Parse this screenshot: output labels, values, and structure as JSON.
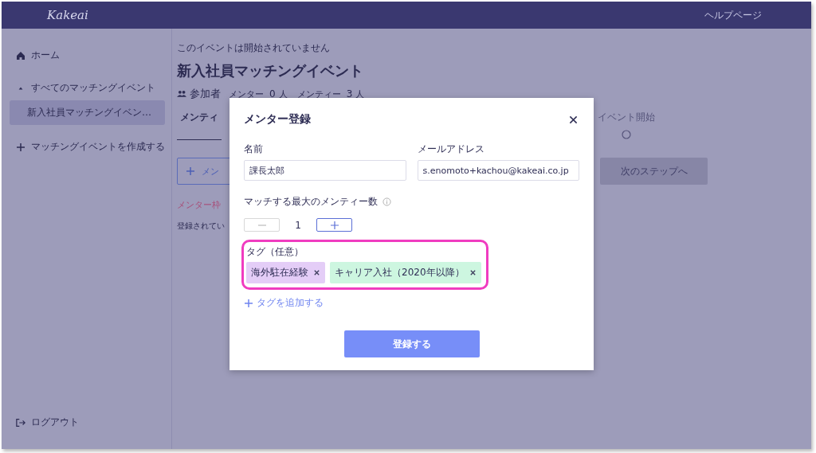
{
  "header": {
    "logo": "Kakeai",
    "help_link": "ヘルプページ"
  },
  "sidebar": {
    "items": [
      {
        "kind": "home",
        "label": "ホーム",
        "selected": false
      },
      {
        "kind": "group",
        "label": "すべてのマッチングイベント",
        "expanded": true,
        "children": [
          {
            "label": "新入社員マッチングイベン…",
            "selected": true
          }
        ]
      },
      {
        "kind": "create",
        "label": "マッチングイベントを作成する",
        "selected": false
      }
    ],
    "logout": "ログアウト"
  },
  "event": {
    "status": "このイベントは開始されていません",
    "title": "新入社員マッチングイベント",
    "participants_label": "参加者",
    "mentor_label": "メンター",
    "mentor_count": "0",
    "mentor_unit": "人",
    "mentee_label": "メンティー",
    "mentee_count": "3",
    "mentee_unit": "人"
  },
  "steps": [
    {
      "label": "メンティ",
      "selected": true
    },
    {
      "label": "イベント開始",
      "selected": false
    }
  ],
  "add_button": "メン",
  "next_button": "次のステップへ",
  "warning": "メンター枠",
  "note": "登録されてい",
  "modal": {
    "title": "メンター登録",
    "fields": [
      {
        "label": "名前",
        "value": "課長太郎"
      },
      {
        "label": "メールアドレス",
        "value": "s.enomoto+kachou@kakeai.co.jp"
      }
    ],
    "max_label": "マッチする最大のメンティー数",
    "count": "1",
    "minus_disabled": true,
    "tags_label": "タグ（任意）",
    "tags_highlighted": true,
    "tags": [
      {
        "label": "海外駐在経験",
        "color": "#e4cdf7"
      },
      {
        "label": "キャリア入社（2020年以降）",
        "color": "#cdf6e0"
      }
    ],
    "add_tag": "タグを追加する",
    "submit": "登録する"
  }
}
